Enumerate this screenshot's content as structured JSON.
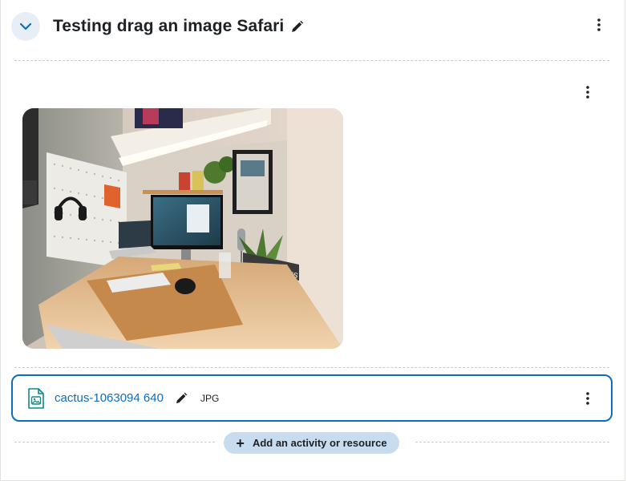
{
  "section": {
    "title": "Testing drag an image Safari"
  },
  "file": {
    "name": "cactus-1063094 640",
    "type": "JPG"
  },
  "add": {
    "label": "Add an activity or resource"
  },
  "image": {
    "alt": "Desk setup with monitor, laptop, keyboard, mouse and cork desk mat"
  },
  "colors": {
    "accent": "#0f6cbf",
    "add_button_bg": "#c8dcef",
    "collapse_bg": "#e8eef5"
  }
}
